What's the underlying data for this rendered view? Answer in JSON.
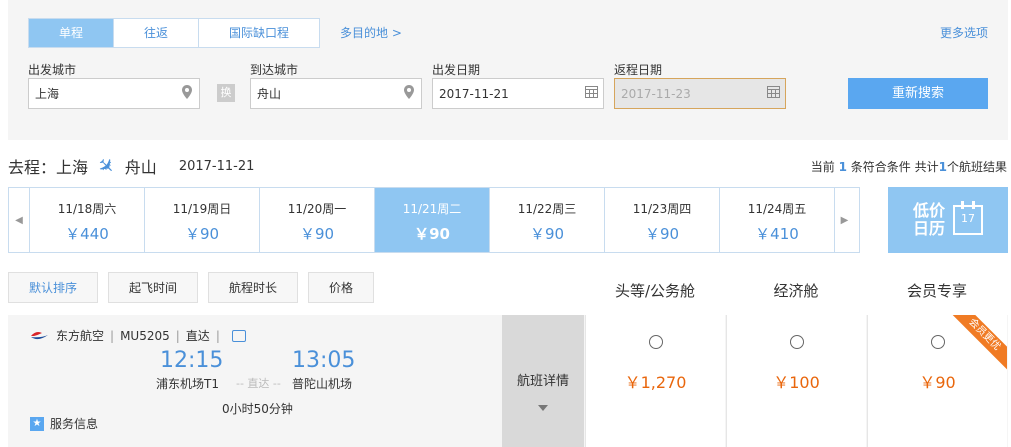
{
  "search": {
    "tabs": [
      "单程",
      "往返",
      "国际缺口程"
    ],
    "multi_dest": "多目的地 >",
    "more_options": "更多选项",
    "depart_city_label": "出发城市",
    "depart_city": "上海",
    "swap_label": "换",
    "arrive_city_label": "到达城市",
    "arrive_city": "舟山",
    "depart_date_label": "出发日期",
    "depart_date": "2017-11-21",
    "return_date_label": "返程日期",
    "return_date": "2017-11-23",
    "search_button": "重新搜索"
  },
  "route": {
    "prefix": "去程：",
    "from": "上海",
    "to": "舟山",
    "date": "2017-11-21"
  },
  "result": {
    "text1": "当前",
    "count": "1",
    "text2": "条符合条件 共计",
    "total": "1",
    "text3": "个航班结果"
  },
  "dates": [
    {
      "label": "11/18周六",
      "price": "￥440"
    },
    {
      "label": "11/19周日",
      "price": "￥90"
    },
    {
      "label": "11/20周一",
      "price": "￥90"
    },
    {
      "label": "11/21周二",
      "price": "￥90"
    },
    {
      "label": "11/22周三",
      "price": "￥90"
    },
    {
      "label": "11/23周四",
      "price": "￥90"
    },
    {
      "label": "11/24周五",
      "price": "￥410"
    }
  ],
  "low_price_calendar": {
    "line1": "低价",
    "line2": "日历",
    "day": "17"
  },
  "sort": [
    "默认排序",
    "起飞时间",
    "航程时长",
    "价格"
  ],
  "cabins": [
    "头等/公务舱",
    "经济舱",
    "会员专享"
  ],
  "flight": {
    "airline": "东方航空",
    "number": "MU5205",
    "type": "直达",
    "dep_time": "12:15",
    "arr_time": "13:05",
    "dep_airport": "浦东机场T1",
    "direct": "-- 直达 --",
    "arr_airport": "普陀山机场",
    "duration": "0小时50分钟",
    "service": "服务信息",
    "details": "航班详情",
    "prices": [
      "￥1,270",
      "￥100",
      "￥90"
    ],
    "ribbon": "会员更优"
  },
  "colors": {
    "accent": "#4a90d9",
    "active_bg": "#8fc6f2",
    "price": "#e9660c",
    "ribbon": "#f07b24"
  }
}
